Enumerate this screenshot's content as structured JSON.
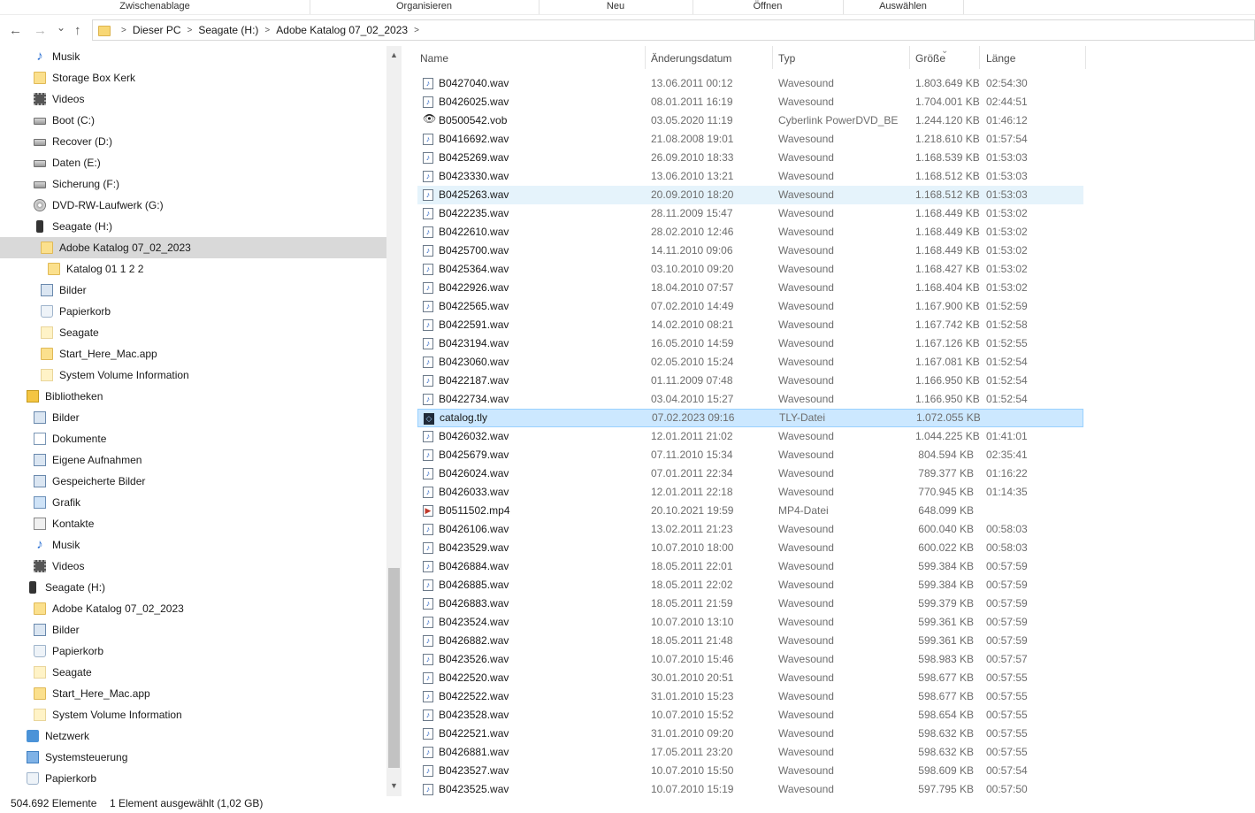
{
  "ribbon": {
    "groups": [
      "Zwischenablage",
      "Organisieren",
      "Neu",
      "Öffnen",
      "Auswählen"
    ]
  },
  "address": {
    "back": "←",
    "forward": "→",
    "recent": "⌄",
    "up": "↑",
    "crumbs": [
      "Dieser PC",
      "Seagate (H:)",
      "Adobe Katalog 07_02_2023"
    ]
  },
  "nav": {
    "items": [
      {
        "label": "Musik",
        "icon": "music-icon",
        "indent": 38
      },
      {
        "label": "Storage Box Kerk",
        "icon": "folder-icon",
        "indent": 38
      },
      {
        "label": "Videos",
        "icon": "video-icon",
        "indent": 38
      },
      {
        "label": "Boot (C:)",
        "icon": "drive-icon",
        "indent": 38
      },
      {
        "label": "Recover (D:)",
        "icon": "drive-icon",
        "indent": 38
      },
      {
        "label": "Daten (E:)",
        "icon": "drive-icon",
        "indent": 38
      },
      {
        "label": "Sicherung (F:)",
        "icon": "drive-icon",
        "indent": 38
      },
      {
        "label": "DVD-RW-Laufwerk (G:)",
        "icon": "disc-icon",
        "indent": 38
      },
      {
        "label": "Seagate (H:)",
        "icon": "external-drive-icon",
        "indent": 38
      },
      {
        "label": "Adobe Katalog 07_02_2023",
        "icon": "folder-icon",
        "indent": 46,
        "selected": true
      },
      {
        "label": "Katalog 01 1 2 2",
        "icon": "folder-icon",
        "indent": 54
      },
      {
        "label": "Bilder",
        "icon": "pictures-icon",
        "indent": 46
      },
      {
        "label": "Papierkorb",
        "icon": "recycle-bin-icon",
        "indent": 46
      },
      {
        "label": "Seagate",
        "icon": "folder-light-icon",
        "indent": 46
      },
      {
        "label": "Start_Here_Mac.app",
        "icon": "folder-icon",
        "indent": 46
      },
      {
        "label": "System Volume Information",
        "icon": "folder-light-icon",
        "indent": 46
      },
      {
        "label": "Bibliotheken",
        "icon": "library-icon",
        "indent": 30
      },
      {
        "label": "Bilder",
        "icon": "pictures-icon",
        "indent": 38
      },
      {
        "label": "Dokumente",
        "icon": "documents-icon",
        "indent": 38
      },
      {
        "label": "Eigene Aufnahmen",
        "icon": "pictures-icon",
        "indent": 38
      },
      {
        "label": "Gespeicherte Bilder",
        "icon": "pictures-icon",
        "indent": 38
      },
      {
        "label": "Grafik",
        "icon": "graphic-icon",
        "indent": 38
      },
      {
        "label": "Kontakte",
        "icon": "contacts-icon",
        "indent": 38
      },
      {
        "label": "Musik",
        "icon": "music-icon",
        "indent": 38
      },
      {
        "label": "Videos",
        "icon": "video-icon",
        "indent": 38
      },
      {
        "label": "Seagate (H:)",
        "icon": "external-drive-icon",
        "indent": 30
      },
      {
        "label": "Adobe Katalog 07_02_2023",
        "icon": "folder-icon",
        "indent": 38
      },
      {
        "label": "Bilder",
        "icon": "pictures-icon",
        "indent": 38
      },
      {
        "label": "Papierkorb",
        "icon": "recycle-bin-icon",
        "indent": 38
      },
      {
        "label": "Seagate",
        "icon": "folder-light-icon",
        "indent": 38
      },
      {
        "label": "Start_Here_Mac.app",
        "icon": "folder-icon",
        "indent": 38
      },
      {
        "label": "System Volume Information",
        "icon": "folder-light-icon",
        "indent": 38
      },
      {
        "label": "Netzwerk",
        "icon": "network-icon",
        "indent": 30
      },
      {
        "label": "Systemsteuerung",
        "icon": "control-panel-icon",
        "indent": 30
      },
      {
        "label": "Papierkorb",
        "icon": "recycle-bin-icon",
        "indent": 30
      }
    ]
  },
  "columns": {
    "name": "Name",
    "date": "Änderungsdatum",
    "type": "Typ",
    "size": "Größe",
    "length": "Länge",
    "sort_indicator": "⌄"
  },
  "files": [
    {
      "name": "B0427040.wav",
      "date": "13.06.2011 00:12",
      "type": "Wavesound",
      "size": "1.803.649 KB",
      "length": "02:54:30",
      "icon": "wav"
    },
    {
      "name": "B0426025.wav",
      "date": "08.01.2011 16:19",
      "type": "Wavesound",
      "size": "1.704.001 KB",
      "length": "02:44:51",
      "icon": "wav"
    },
    {
      "name": "B0500542.vob",
      "date": "03.05.2020 11:19",
      "type": "Cyberlink PowerDVD_BE",
      "size": "1.244.120 KB",
      "length": "01:46:12",
      "icon": "vob"
    },
    {
      "name": "B0416692.wav",
      "date": "21.08.2008 19:01",
      "type": "Wavesound",
      "size": "1.218.610 KB",
      "length": "01:57:54",
      "icon": "wav"
    },
    {
      "name": "B0425269.wav",
      "date": "26.09.2010 18:33",
      "type": "Wavesound",
      "size": "1.168.539 KB",
      "length": "01:53:03",
      "icon": "wav"
    },
    {
      "name": "B0423330.wav",
      "date": "13.06.2010 13:21",
      "type": "Wavesound",
      "size": "1.168.512 KB",
      "length": "01:53:03",
      "icon": "wav"
    },
    {
      "name": "B0425263.wav",
      "date": "20.09.2010 18:20",
      "type": "Wavesound",
      "size": "1.168.512 KB",
      "length": "01:53:03",
      "icon": "wav",
      "state": "hot"
    },
    {
      "name": "B0422235.wav",
      "date": "28.11.2009 15:47",
      "type": "Wavesound",
      "size": "1.168.449 KB",
      "length": "01:53:02",
      "icon": "wav"
    },
    {
      "name": "B0422610.wav",
      "date": "28.02.2010 12:46",
      "type": "Wavesound",
      "size": "1.168.449 KB",
      "length": "01:53:02",
      "icon": "wav"
    },
    {
      "name": "B0425700.wav",
      "date": "14.11.2010 09:06",
      "type": "Wavesound",
      "size": "1.168.449 KB",
      "length": "01:53:02",
      "icon": "wav"
    },
    {
      "name": "B0425364.wav",
      "date": "03.10.2010 09:20",
      "type": "Wavesound",
      "size": "1.168.427 KB",
      "length": "01:53:02",
      "icon": "wav"
    },
    {
      "name": "B0422926.wav",
      "date": "18.04.2010 07:57",
      "type": "Wavesound",
      "size": "1.168.404 KB",
      "length": "01:53:02",
      "icon": "wav"
    },
    {
      "name": "B0422565.wav",
      "date": "07.02.2010 14:49",
      "type": "Wavesound",
      "size": "1.167.900 KB",
      "length": "01:52:59",
      "icon": "wav"
    },
    {
      "name": "B0422591.wav",
      "date": "14.02.2010 08:21",
      "type": "Wavesound",
      "size": "1.167.742 KB",
      "length": "01:52:58",
      "icon": "wav"
    },
    {
      "name": "B0423194.wav",
      "date": "16.05.2010 14:59",
      "type": "Wavesound",
      "size": "1.167.126 KB",
      "length": "01:52:55",
      "icon": "wav"
    },
    {
      "name": "B0423060.wav",
      "date": "02.05.2010 15:24",
      "type": "Wavesound",
      "size": "1.167.081 KB",
      "length": "01:52:54",
      "icon": "wav"
    },
    {
      "name": "B0422187.wav",
      "date": "01.11.2009 07:48",
      "type": "Wavesound",
      "size": "1.166.950 KB",
      "length": "01:52:54",
      "icon": "wav"
    },
    {
      "name": "B0422734.wav",
      "date": "03.04.2010 15:27",
      "type": "Wavesound",
      "size": "1.166.950 KB",
      "length": "01:52:54",
      "icon": "wav"
    },
    {
      "name": "catalog.tly",
      "date": "07.02.2023 09:16",
      "type": "TLY-Datei",
      "size": "1.072.055 KB",
      "length": "",
      "icon": "tly",
      "state": "selected"
    },
    {
      "name": "B0426032.wav",
      "date": "12.01.2011 21:02",
      "type": "Wavesound",
      "size": "1.044.225 KB",
      "length": "01:41:01",
      "icon": "wav"
    },
    {
      "name": "B0425679.wav",
      "date": "07.11.2010 15:34",
      "type": "Wavesound",
      "size": "804.594 KB",
      "length": "02:35:41",
      "icon": "wav"
    },
    {
      "name": "B0426024.wav",
      "date": "07.01.2011 22:34",
      "type": "Wavesound",
      "size": "789.377 KB",
      "length": "01:16:22",
      "icon": "wav"
    },
    {
      "name": "B0426033.wav",
      "date": "12.01.2011 22:18",
      "type": "Wavesound",
      "size": "770.945 KB",
      "length": "01:14:35",
      "icon": "wav"
    },
    {
      "name": "B0511502.mp4",
      "date": "20.10.2021 19:59",
      "type": "MP4-Datei",
      "size": "648.099 KB",
      "length": "",
      "icon": "mp4"
    },
    {
      "name": "B0426106.wav",
      "date": "13.02.2011 21:23",
      "type": "Wavesound",
      "size": "600.040 KB",
      "length": "00:58:03",
      "icon": "wav"
    },
    {
      "name": "B0423529.wav",
      "date": "10.07.2010 18:00",
      "type": "Wavesound",
      "size": "600.022 KB",
      "length": "00:58:03",
      "icon": "wav"
    },
    {
      "name": "B0426884.wav",
      "date": "18.05.2011 22:01",
      "type": "Wavesound",
      "size": "599.384 KB",
      "length": "00:57:59",
      "icon": "wav"
    },
    {
      "name": "B0426885.wav",
      "date": "18.05.2011 22:02",
      "type": "Wavesound",
      "size": "599.384 KB",
      "length": "00:57:59",
      "icon": "wav"
    },
    {
      "name": "B0426883.wav",
      "date": "18.05.2011 21:59",
      "type": "Wavesound",
      "size": "599.379 KB",
      "length": "00:57:59",
      "icon": "wav"
    },
    {
      "name": "B0423524.wav",
      "date": "10.07.2010 13:10",
      "type": "Wavesound",
      "size": "599.361 KB",
      "length": "00:57:59",
      "icon": "wav"
    },
    {
      "name": "B0426882.wav",
      "date": "18.05.2011 21:48",
      "type": "Wavesound",
      "size": "599.361 KB",
      "length": "00:57:59",
      "icon": "wav"
    },
    {
      "name": "B0423526.wav",
      "date": "10.07.2010 15:46",
      "type": "Wavesound",
      "size": "598.983 KB",
      "length": "00:57:57",
      "icon": "wav"
    },
    {
      "name": "B0422520.wav",
      "date": "30.01.2010 20:51",
      "type": "Wavesound",
      "size": "598.677 KB",
      "length": "00:57:55",
      "icon": "wav"
    },
    {
      "name": "B0422522.wav",
      "date": "31.01.2010 15:23",
      "type": "Wavesound",
      "size": "598.677 KB",
      "length": "00:57:55",
      "icon": "wav"
    },
    {
      "name": "B0423528.wav",
      "date": "10.07.2010 15:52",
      "type": "Wavesound",
      "size": "598.654 KB",
      "length": "00:57:55",
      "icon": "wav"
    },
    {
      "name": "B0422521.wav",
      "date": "31.01.2010 09:20",
      "type": "Wavesound",
      "size": "598.632 KB",
      "length": "00:57:55",
      "icon": "wav"
    },
    {
      "name": "B0426881.wav",
      "date": "17.05.2011 23:20",
      "type": "Wavesound",
      "size": "598.632 KB",
      "length": "00:57:55",
      "icon": "wav"
    },
    {
      "name": "B0423527.wav",
      "date": "10.07.2010 15:50",
      "type": "Wavesound",
      "size": "598.609 KB",
      "length": "00:57:54",
      "icon": "wav"
    },
    {
      "name": "B0423525.wav",
      "date": "10.07.2010 15:19",
      "type": "Wavesound",
      "size": "597.795 KB",
      "length": "00:57:50",
      "icon": "wav"
    }
  ],
  "status": {
    "count": "504.692 Elemente",
    "selection": "1 Element ausgewählt (1,02 GB)"
  }
}
